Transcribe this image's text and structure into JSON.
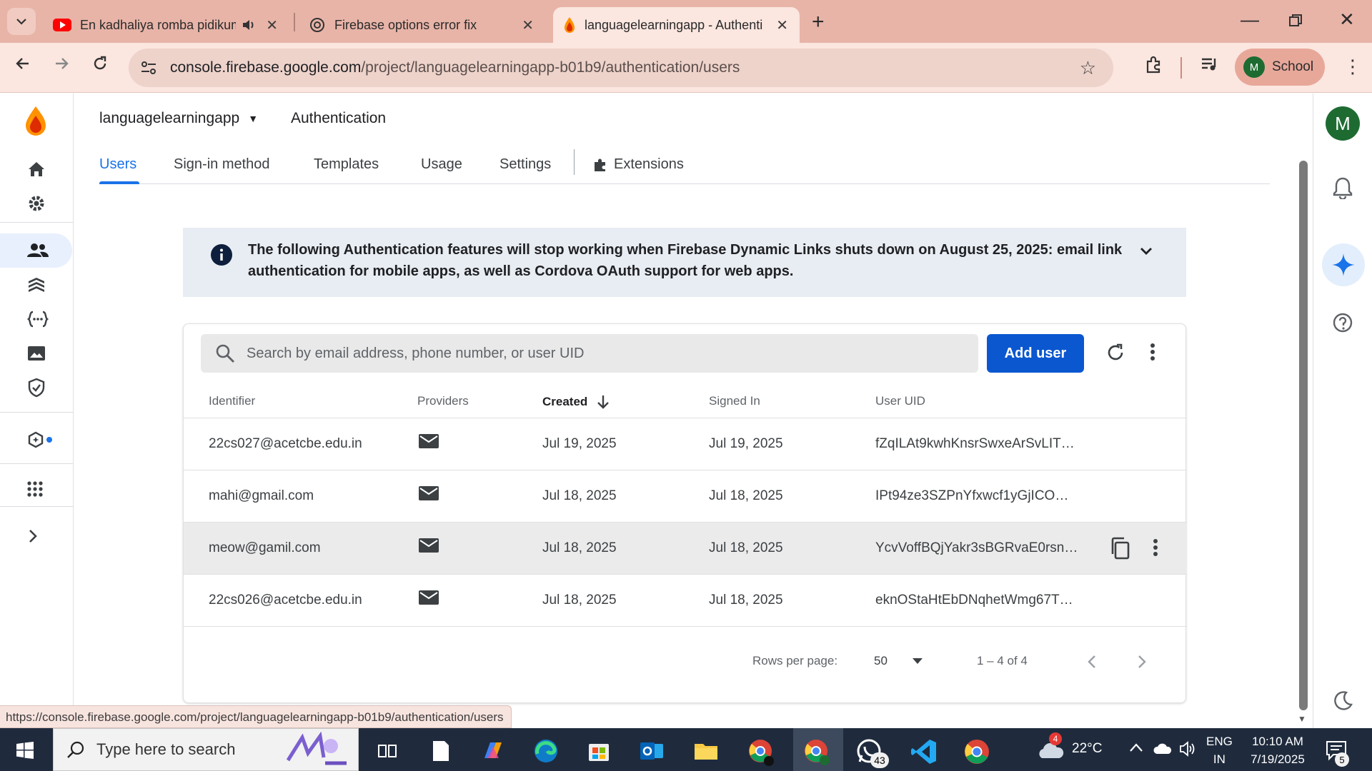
{
  "browser": {
    "tabs": [
      {
        "title": "En kadhaliya romba pidikum",
        "icon": "youtube-icon",
        "audio": true
      },
      {
        "title": "Firebase options error fix",
        "icon": "chatgpt-icon"
      },
      {
        "title": "languagelearningapp - Authentication",
        "icon": "firebase-icon",
        "active": true
      }
    ],
    "url_host": "console.firebase.google.com",
    "url_path": "/project/languagelearningapp-b01b9/authentication/users",
    "profile_initial": "M",
    "profile_label": "School"
  },
  "header": {
    "project": "languagelearningapp",
    "section": "Authentication",
    "avatar_initial": "M"
  },
  "tabs": [
    {
      "label": "Users",
      "active": true
    },
    {
      "label": "Sign-in method"
    },
    {
      "label": "Templates"
    },
    {
      "label": "Usage"
    },
    {
      "label": "Settings"
    },
    {
      "label": "Extensions"
    }
  ],
  "banner": {
    "text": "The following Authentication features will stop working when Firebase Dynamic Links shuts down on August 25, 2025: email link authentication for mobile apps, as well as Cordova OAuth support for web apps."
  },
  "users_table": {
    "search_placeholder": "Search by email address, phone number, or user UID",
    "add_user_label": "Add user",
    "columns": [
      "Identifier",
      "Providers",
      "Created",
      "Signed In",
      "User UID"
    ],
    "rows": [
      {
        "identifier": "22cs027@acetcbe.edu.in",
        "provider": "email-icon",
        "created": "Jul 19, 2025",
        "signed_in": "Jul 19, 2025",
        "uid": "fZqILAt9kwhKnsrSwxeArSvLIT…"
      },
      {
        "identifier": "mahi@gmail.com",
        "provider": "email-icon",
        "created": "Jul 18, 2025",
        "signed_in": "Jul 18, 2025",
        "uid": "IPt94ze3SZPnYfxwcf1yGjICO…"
      },
      {
        "identifier": "meow@gamil.com",
        "provider": "email-icon",
        "created": "Jul 18, 2025",
        "signed_in": "Jul 18, 2025",
        "uid": "YcvVoffBQjYakr3sBGRvaE0rsn…",
        "hovered": true
      },
      {
        "identifier": "22cs026@acetcbe.edu.in",
        "provider": "email-icon",
        "created": "Jul 18, 2025",
        "signed_in": "Jul 18, 2025",
        "uid": "eknOStaHtEbDNqhetWmg67T…"
      }
    ],
    "rows_per_page_label": "Rows per page:",
    "rows_per_page": "50",
    "range": "1 – 4 of 4"
  },
  "status_url": "https://console.firebase.google.com/project/languagelearningapp-b01b9/authentication/users",
  "taskbar": {
    "search_placeholder": "Type here to search",
    "whatsapp_badge": "43",
    "weather_badge": "4",
    "temperature": "22°C",
    "lang_top": "ENG",
    "lang_bottom": "IN",
    "time": "10:10 AM",
    "date": "7/19/2025",
    "notification_count": "5"
  },
  "colors": {
    "accent": "#1a73e8",
    "primary_button": "#0b57d0",
    "tabstrip": "#e8b4a8",
    "banner_bg": "#e8edf3"
  }
}
